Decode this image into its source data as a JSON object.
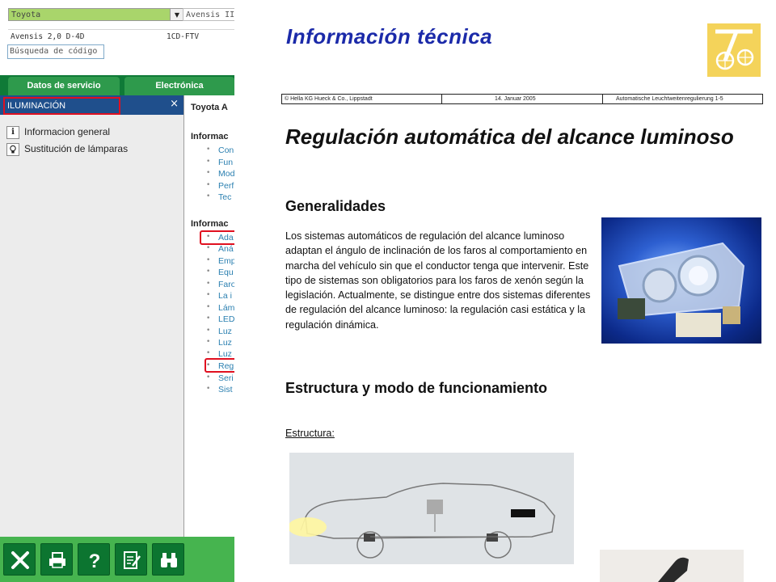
{
  "vehicle": {
    "make": "Toyota",
    "model": "Avensis II",
    "variant": "Avensis 2,0 D-4D",
    "engine_code": "1CD-FTV",
    "code_search_placeholder": "Búsqueda de código"
  },
  "tabs": [
    "Datos de servicio",
    "Electrónica"
  ],
  "side_panel": {
    "title": "ILUMINACIÓN",
    "close": "×",
    "items": [
      {
        "label": "Informacion general",
        "icon": "info-icon"
      },
      {
        "label": "Sustitución de lámparas",
        "icon": "bulb-icon"
      }
    ]
  },
  "content": {
    "breadcrumb": "Toyota A",
    "sections": [
      {
        "heading": "Informac",
        "links": [
          "Con",
          "Fun",
          "Mod",
          "Perf",
          "Tec"
        ]
      },
      {
        "heading": "Informac",
        "links": [
          "Ada",
          "Aná",
          "Emp",
          "Equ",
          "Faro",
          "La i",
          "Lám",
          "LED",
          "Luz",
          "Luz",
          "Luz",
          "Reg",
          "Seri",
          "Sist"
        ]
      }
    ]
  },
  "toolbar": [
    {
      "name": "close-button",
      "icon": "close-icon"
    },
    {
      "name": "print-button",
      "icon": "print-icon"
    },
    {
      "name": "help-button",
      "icon": "help-icon"
    },
    {
      "name": "notes-button",
      "icon": "notes-icon"
    },
    {
      "name": "search-button",
      "icon": "binoculars-icon"
    }
  ],
  "document": {
    "brand": "Información técnica",
    "meta": {
      "company": "© Hella KG Hueck & Co., Lippstadt",
      "date": "14. Januar 2005",
      "ref": "Automatische Leuchtweitenregulierung 1-5"
    },
    "title": "Regulación automática del alcance luminoso",
    "section1_heading": "Generalidades",
    "section1_body": "Los sistemas automáticos de regulación del alcance luminoso adaptan el ángulo de inclinación de los faros al comportamiento en marcha del vehículo sin que el conductor tenga que intervenir. Este tipo de sistemas son obligatorios para los faros de xenón según la legislación. Actualmente, se distingue entre dos sistemas diferentes de regulación del alcance luminoso: la regulación casi estática y la regulación dinámica.",
    "section2_heading": "Estructura y modo de funcionamiento",
    "structure_label": "Estructura:"
  },
  "colors": {
    "green_dark": "#0f7a37",
    "green_tab": "#2e9a4c",
    "green_toolbar": "#46b44f",
    "panel_blue": "#1f4f8c",
    "highlight_red": "#e01020",
    "link_blue": "#2a7fb0",
    "brand_blue": "#1b2aa9",
    "logo_yellow": "#f4d35a"
  }
}
